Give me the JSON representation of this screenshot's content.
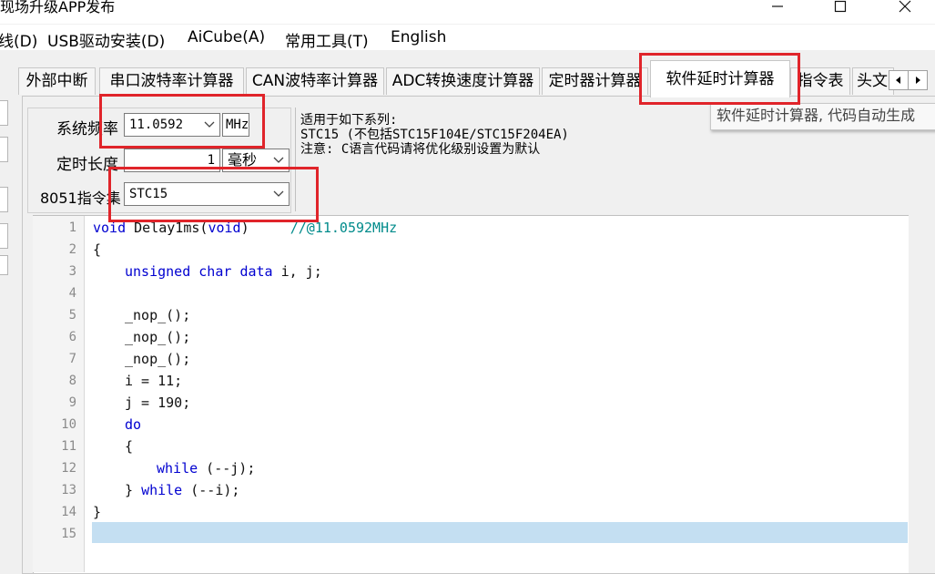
{
  "window": {
    "title": "现场升级APP发布"
  },
  "menu": [
    "线(D)",
    "USB驱动安装(D)",
    "AiCube(A)",
    "常用工具(T)",
    "English"
  ],
  "tabs": [
    "外部中断",
    "串口波特率计算器",
    "CAN波特率计算器",
    "ADC转换速度计算器",
    "定时器计算器",
    "软件延时计算器",
    "指令表",
    "头文"
  ],
  "active_tab": "软件延时计算器",
  "tooltip": "软件延时计算器, 代码自动生成",
  "form": {
    "sys_freq_label": "系统频率",
    "sys_freq_value": "11.0592",
    "sys_freq_unit": "MHz",
    "delay_label": "定时长度",
    "delay_value": "1",
    "delay_unit": "毫秒",
    "isa_label": "8051指令集",
    "isa_value": "STC15"
  },
  "info": {
    "line1": "适用于如下系列:",
    "line2": "STC15 (不包括STC15F104E/STC15F204EA)",
    "line3": "注意: C语言代码请将优化级别设置为默认"
  },
  "code": {
    "line_numbers": [
      "1",
      "2",
      "3",
      "4",
      "5",
      "6",
      "7",
      "8",
      "9",
      "10",
      "11",
      "12",
      "13",
      "14",
      "15"
    ],
    "lines": {
      "l1_kw1": "void",
      "l1_fn": " Delay1ms(",
      "l1_kw2": "void",
      "l1_close": ")",
      "l1_comment": "\t//@11.0592MHz",
      "l2": "{",
      "l3_kw1": "unsigned",
      "l3_kw2": "char",
      "l3_kw3": "data",
      "l3_rest": " i, j;",
      "l5": "_nop_();",
      "l6": "_nop_();",
      "l7": "_nop_();",
      "l8": "i = 11;",
      "l9": "j = 190;",
      "l10": "do",
      "l11": "{",
      "l12_kw": "while",
      "l12_rest": " (--j);",
      "l13_open": "} ",
      "l13_kw": "while",
      "l13_rest": " (--i);",
      "l14": "}"
    }
  }
}
